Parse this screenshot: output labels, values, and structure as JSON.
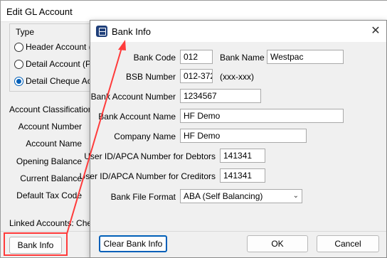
{
  "gl_dialog": {
    "title": "Edit GL Account",
    "type_group": {
      "legend": "Type",
      "options": [
        {
          "label": "Header Account (n",
          "checked": false
        },
        {
          "label": "Detail Account (Pos",
          "checked": false
        },
        {
          "label": "Detail Cheque Acco",
          "checked": true
        }
      ]
    },
    "account_classification_label": "Account Classification",
    "field_labels": [
      "Account Number",
      "Account Name",
      "Opening Balance",
      "Current Balance",
      "Default Tax Code"
    ],
    "linked_accounts_label": "Linked Accounts: Cheque",
    "bank_info_button": "Bank Info"
  },
  "bank_dialog": {
    "title": "Bank Info",
    "close_icon": "close-icon",
    "bank_code": {
      "label": "Bank Code",
      "value": "012"
    },
    "bank_name": {
      "label": "Bank Name",
      "value": "Westpac"
    },
    "bsb_number": {
      "label": "BSB Number",
      "value": "012-372",
      "hint": "(xxx-xxx)"
    },
    "bank_account_number": {
      "label": "Bank Account Number",
      "value": "1234567"
    },
    "bank_account_name": {
      "label": "Bank Account Name",
      "value": "HF Demo"
    },
    "company_name": {
      "label": "Company Name",
      "value": "HF Demo"
    },
    "user_id_debtors": {
      "label": "User ID/APCA Number for Debtors",
      "value": "141341"
    },
    "user_id_creditors": {
      "label": "User ID/APCA Number for Creditors",
      "value": "141341"
    },
    "bank_file_format": {
      "label": "Bank File Format",
      "value": "ABA (Self Balancing)"
    },
    "buttons": {
      "clear": "Clear Bank Info",
      "ok": "OK",
      "cancel": "Cancel"
    }
  },
  "colors": {
    "highlight": "#ff3b3b",
    "accent": "#005fb8"
  }
}
